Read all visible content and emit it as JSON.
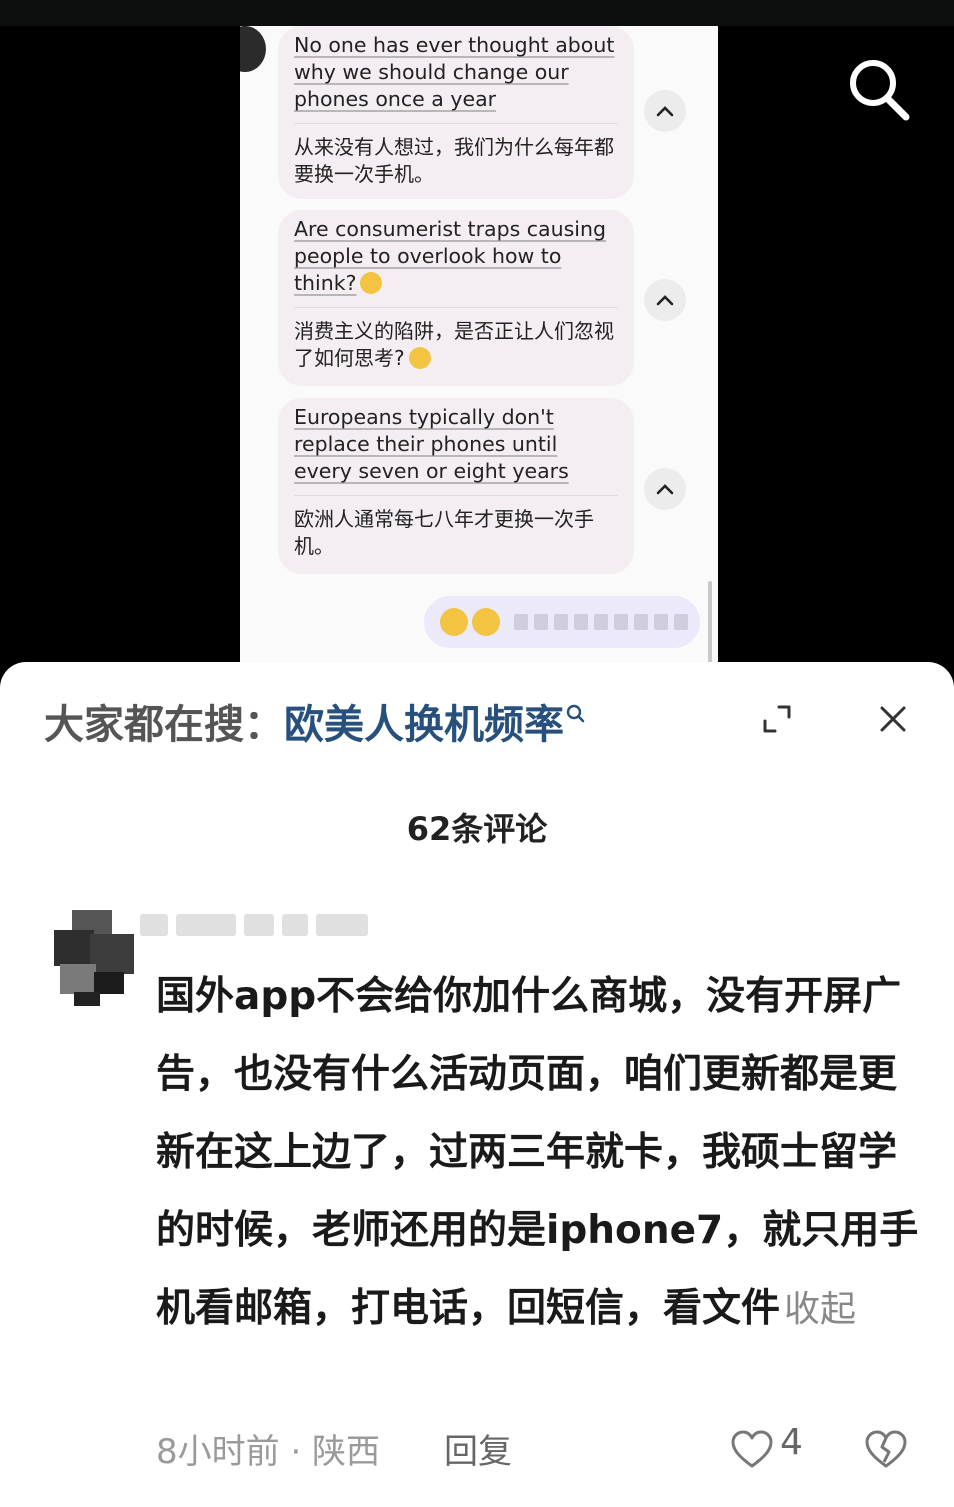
{
  "screenshot": {
    "messages": [
      {
        "en": "No one has ever thought about why we should change our phones once a year",
        "zh": "从来没有人想过，我们为什么每年都要换一次手机。"
      },
      {
        "en": "Are consumerist traps causing people to overlook how to think?",
        "zh": "消费主义的陷阱，是否正让人们忽视了如何思考?"
      },
      {
        "en": "Europeans typically don't replace their phones until every seven or eight years",
        "zh": "欧洲人通常每七八年才更换一次手机。"
      }
    ]
  },
  "search_bar": {
    "prefix": "大家都在搜：",
    "term": "欧美人换机频率"
  },
  "comments": {
    "count_label": "62条评论",
    "items": [
      {
        "text": "国外app不会给你加什么商城，没有开屏广告，也没有什么活动页面，咱们更新都是更新在这上边了，过两三年就卡，我硕士留学的时候，老师还用的是iphone7，就只用手机看邮箱，打电话，回短信，看文件",
        "collapse_label": "收起",
        "meta": "8小时前 · 陕西",
        "reply_label": "回复",
        "likes": "4"
      }
    ]
  },
  "colors": {
    "accent_link": "#27507c",
    "bubble_bg": "#f4eef3",
    "my_bubble_bg": "#ece9fb"
  },
  "icons": [
    "search-icon",
    "expand-icon",
    "close-icon",
    "chevron-up-icon",
    "heart-icon",
    "dislike-icon"
  ]
}
